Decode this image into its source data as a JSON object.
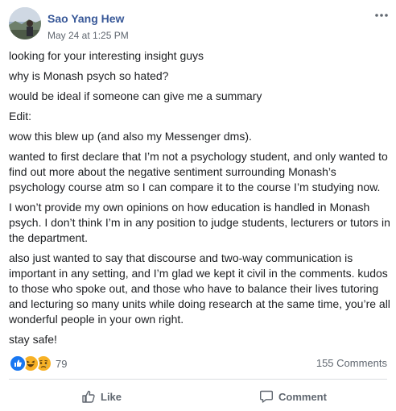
{
  "post": {
    "author": "Sao Yang Hew",
    "timestamp": "May 24 at 1:25 PM",
    "paragraphs": [
      "looking for your interesting insight guys",
      "why is Monash psych so hated?",
      "would be ideal if someone can give me a summary",
      "Edit:",
      "wow this blew up (and also my Messenger dms).",
      "wanted to first declare that I’m not a psychology student, and only wanted to find out more about the negative sentiment surrounding Monash’s psychology course atm so I can compare it to the course I’m studying now.",
      "I won’t provide my own opinions on how education is handled in Monash psych. I don’t think I’m in any position to judge students, lecturers or tutors in the department.",
      "also just wanted to say that discourse and two-way communication is important in any setting, and I’m glad we kept it civil in the comments. kudos to those who spoke out, and those who have to balance their lives tutoring and lecturing so many units while doing research at the same time, you’re all wonderful people in your own right.",
      "stay safe!"
    ],
    "reactions": {
      "icons": [
        "like-icon",
        "haha-icon",
        "sad-icon"
      ],
      "count": "79"
    },
    "comments_count": "155 Comments"
  },
  "actions": {
    "like_label": "Like",
    "comment_label": "Comment"
  },
  "colors": {
    "author": "#385898",
    "like_blue": "#1877f2",
    "emoji_yellow": "#f7b125",
    "meta_gray": "#606770"
  }
}
